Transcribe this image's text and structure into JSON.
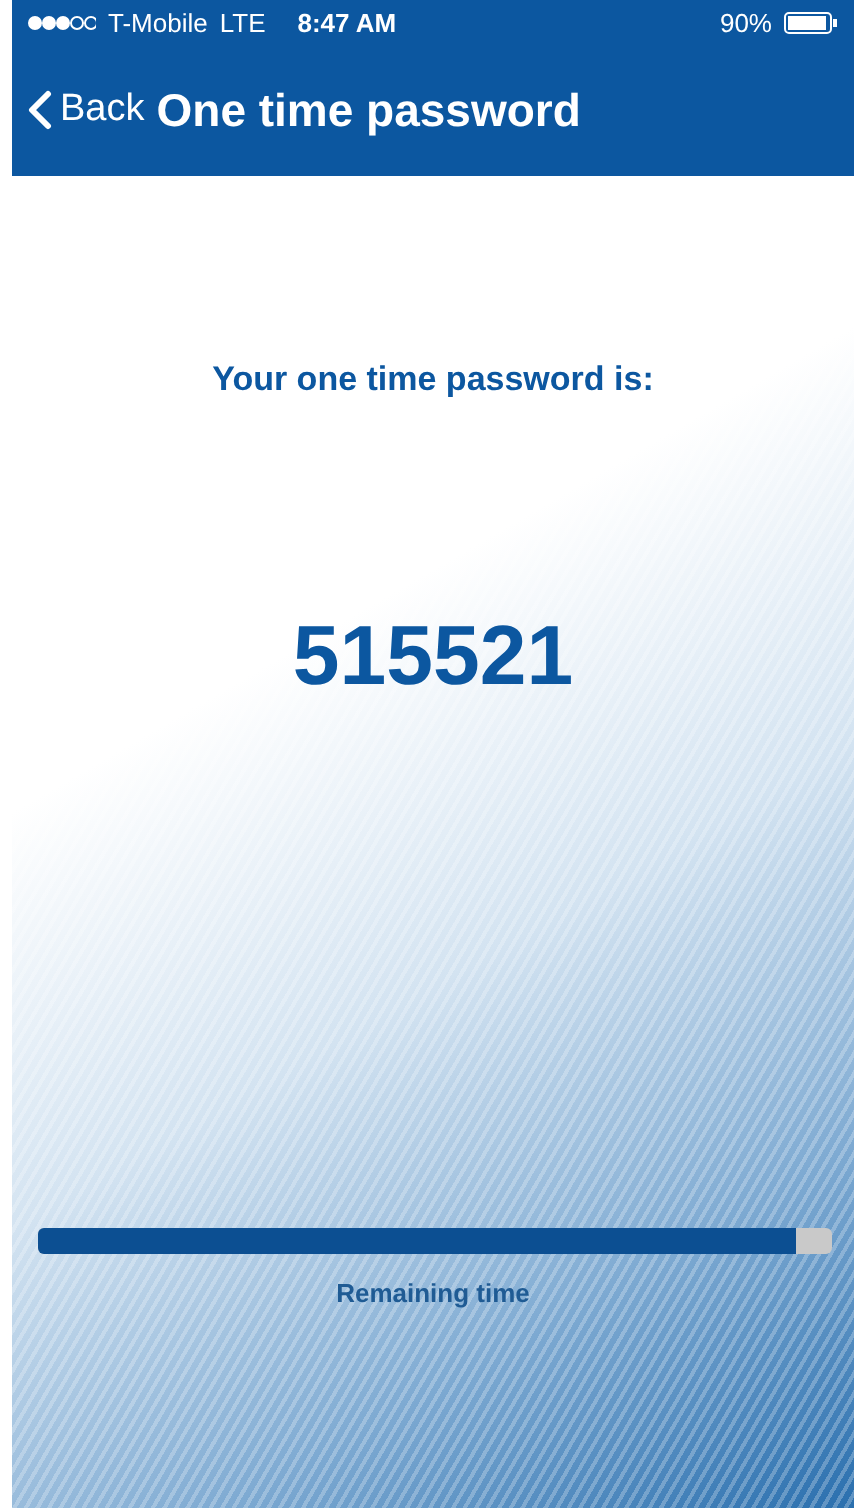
{
  "status_bar": {
    "carrier": "T-Mobile",
    "network": "LTE",
    "time": "8:47 AM",
    "battery": "90%"
  },
  "nav_bar": {
    "back": "Back",
    "title": "One time password"
  },
  "prompt": "Your one time password is:",
  "password": "515521",
  "timer": {
    "level": 0.955,
    "label": "Remaining time"
  }
}
